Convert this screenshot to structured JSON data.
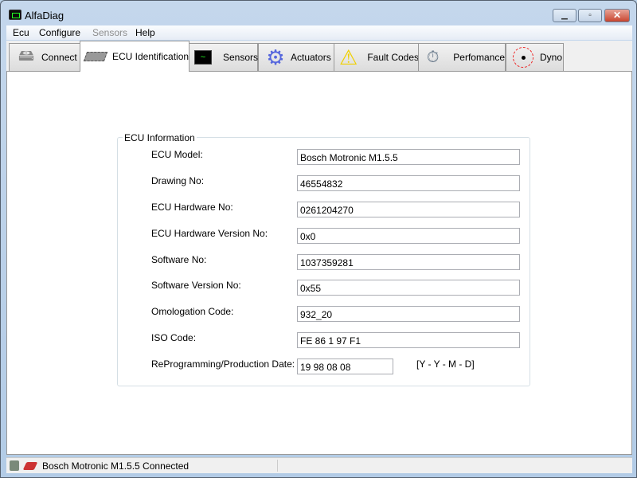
{
  "window": {
    "title": "AlfaDiag"
  },
  "menu": [
    "Ecu",
    "Configure",
    "Sensors",
    "Help"
  ],
  "tabs": [
    "Connect",
    "ECU Identification",
    "Sensors",
    "Actuators",
    "Fault Codes",
    "Perfomance",
    "Dyno"
  ],
  "group": {
    "title": "ECU Information",
    "fields": [
      {
        "label": "ECU Model:",
        "value": "Bosch Motronic M1.5.5"
      },
      {
        "label": "Drawing No:",
        "value": "46554832"
      },
      {
        "label": "ECU Hardware No:",
        "value": "0261204270"
      },
      {
        "label": "ECU Hardware Version No:",
        "value": "0x0"
      },
      {
        "label": "Software No:",
        "value": "1037359281"
      },
      {
        "label": "Software Version No:",
        "value": "0x55"
      },
      {
        "label": "Omologation Code:",
        "value": "932_20"
      },
      {
        "label": "ISO Code:",
        "value": "FE 86 1 97 F1"
      },
      {
        "label": "ReProgramming/Production Date:",
        "value": "19 98 08 08"
      }
    ],
    "date_format": "[Y - Y - M - D]"
  },
  "status": {
    "text": "Bosch Motronic M1.5.5 Connected"
  }
}
